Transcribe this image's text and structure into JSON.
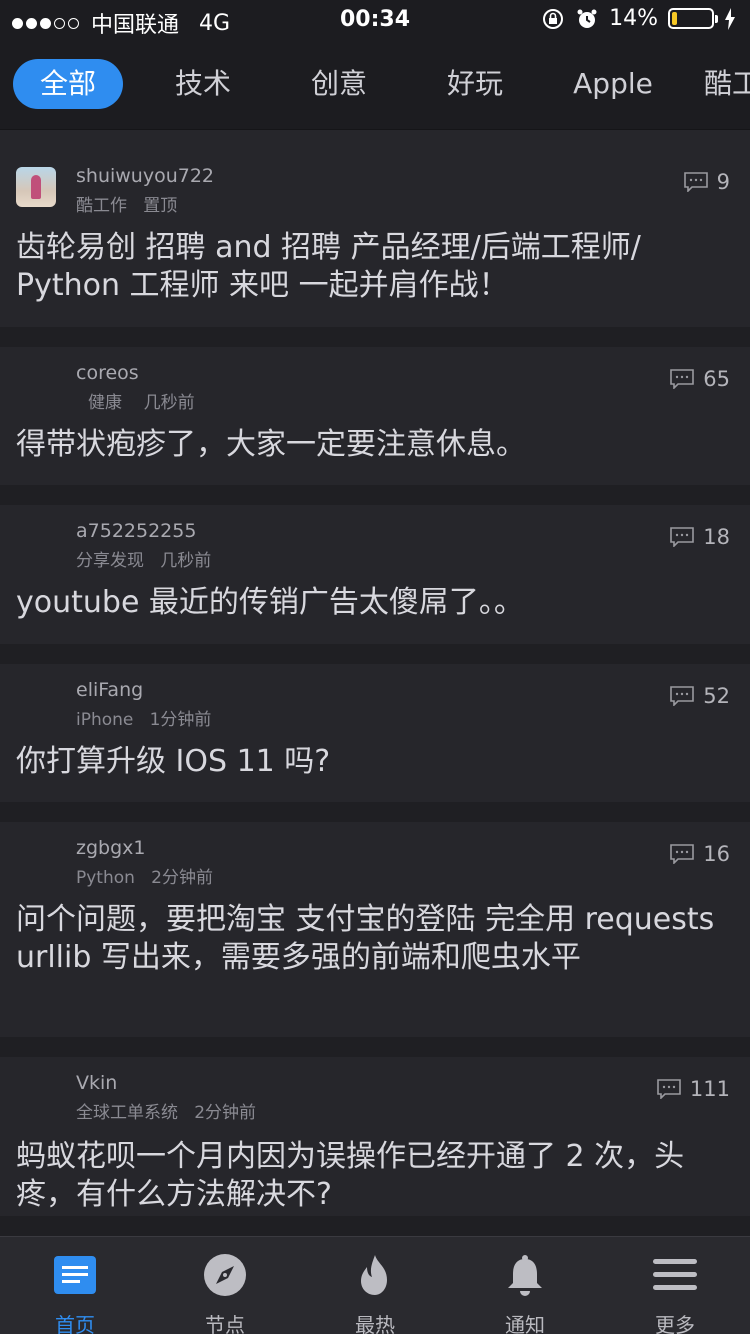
{
  "status_bar": {
    "carrier": "中国联通",
    "network": "4G",
    "time": "00:34",
    "battery_percent_text": "14%",
    "battery_level": 0.14,
    "icons": [
      "signal-dots",
      "rotation-lock-icon",
      "alarm-icon",
      "battery-icon",
      "charging-bolt-icon"
    ]
  },
  "tabs": [
    {
      "label": "全部",
      "active": true
    },
    {
      "label": "技术",
      "active": false
    },
    {
      "label": "创意",
      "active": false
    },
    {
      "label": "好玩",
      "active": false
    },
    {
      "label": "Apple",
      "active": false
    },
    {
      "label": "酷工",
      "active": false
    }
  ],
  "topics": [
    {
      "username": "shuiwuyou722",
      "node": "酷工作",
      "time": "置顶",
      "comments": "9",
      "title": "齿轮易创  招聘  and  招聘  产品经理/后端工程师/ Python 工程师 来吧 一起并肩作战！",
      "has_avatar": true
    },
    {
      "username": "coreos",
      "node": "健康",
      "time": "几秒前",
      "comments": "65",
      "title": "得带状疱疹了，大家一定要注意休息。",
      "has_avatar": false
    },
    {
      "username": "a752252255",
      "node": "分享发现",
      "time": "几秒前",
      "comments": "18",
      "title": "youtube 最近的传销广告太傻屌了。。",
      "has_avatar": false
    },
    {
      "username": "eliFang",
      "node": "iPhone",
      "time": "1分钟前",
      "comments": "52",
      "title": "你打算升级 IOS 11 吗?",
      "has_avatar": false
    },
    {
      "username": "zgbgx1",
      "node": "Python",
      "time": "2分钟前",
      "comments": "16",
      "title": "问个问题，要把淘宝  支付宝的登陆  完全用 requests urllib 写出来，需要多强的前端和爬虫水平",
      "has_avatar": false
    },
    {
      "username": "Vkin",
      "node": "全球工单系统",
      "time": "2分钟前",
      "comments": "111",
      "title": "蚂蚁花呗一个月内因为误操作已经开通了  2  次，头疼，有什么方法解决不?",
      "has_avatar": false
    }
  ],
  "bottom_nav": [
    {
      "label": "首页",
      "icon": "home-list-icon",
      "active": true
    },
    {
      "label": "节点",
      "icon": "compass-icon",
      "active": false
    },
    {
      "label": "最热",
      "icon": "flame-icon",
      "active": false
    },
    {
      "label": "通知",
      "icon": "bell-icon",
      "active": false
    },
    {
      "label": "更多",
      "icon": "menu-icon",
      "active": false
    }
  ],
  "colors": {
    "accent": "#2f8df0",
    "background": "#26262b",
    "bar": "#1c1c20"
  }
}
